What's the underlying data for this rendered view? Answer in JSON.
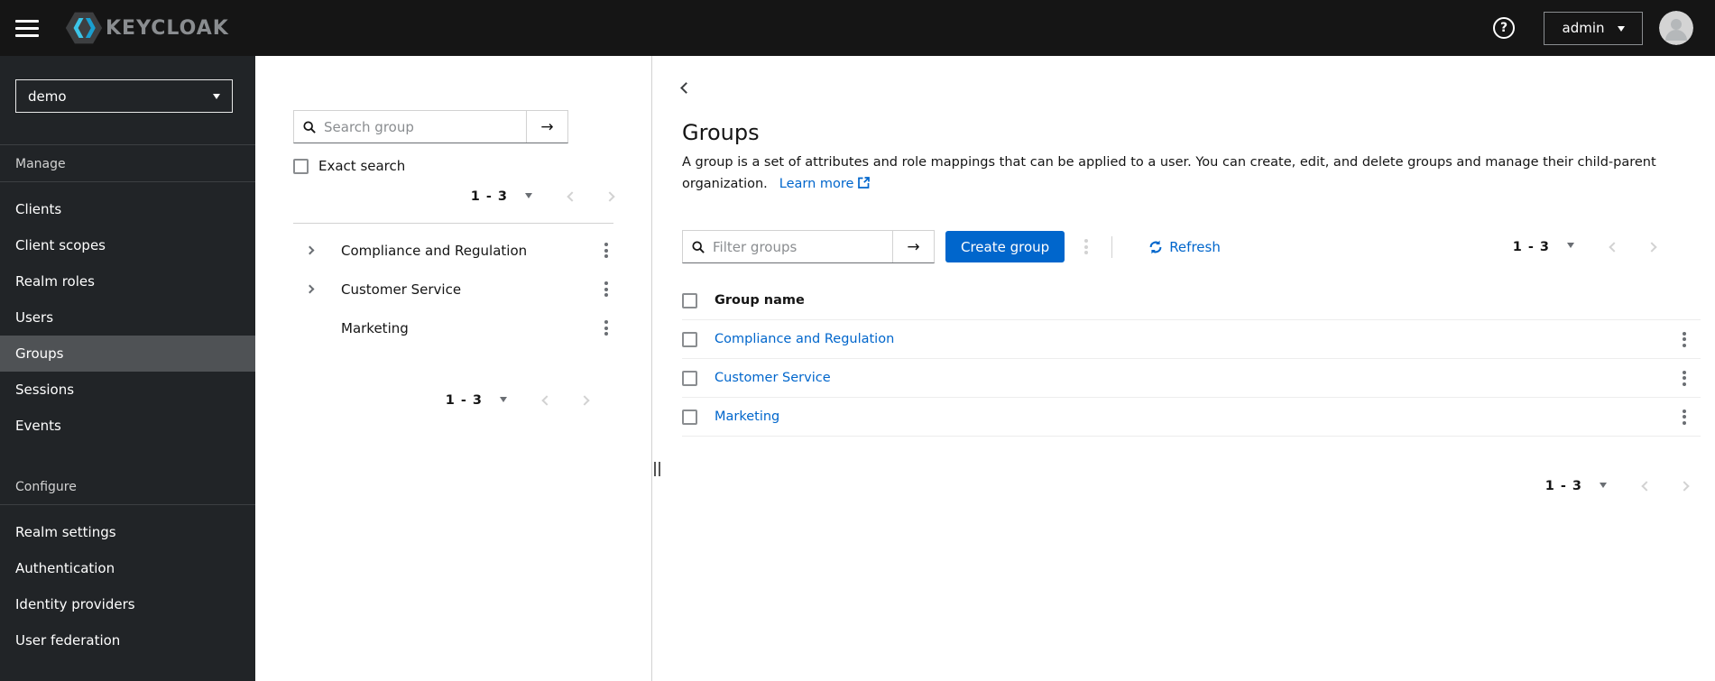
{
  "header": {
    "brand_text": "KEYCLOAK",
    "help_icon": "?",
    "user_menu_label": "admin"
  },
  "sidebar": {
    "realm_select_value": "demo",
    "manage_section_label": "Manage",
    "manage_items": [
      "Clients",
      "Client scopes",
      "Realm roles",
      "Users",
      "Groups",
      "Sessions",
      "Events"
    ],
    "active_item": "Groups",
    "configure_section_label": "Configure",
    "configure_items": [
      "Realm settings",
      "Authentication",
      "Identity providers",
      "User federation"
    ]
  },
  "group_tree": {
    "search_placeholder": "Search group",
    "search_submit_icon": "→",
    "exact_search_label": "Exact search",
    "pagination_top": "1 - 3",
    "items": [
      {
        "label": "Compliance and Regulation",
        "expandable": true
      },
      {
        "label": "Customer Service",
        "expandable": true
      },
      {
        "label": "Marketing",
        "expandable": false
      }
    ],
    "pagination_bottom": "1 - 3"
  },
  "main": {
    "title": "Groups",
    "description": "A group is a set of attributes and role mappings that can be applied to a user. You can create, edit, and delete groups and manage their child-parent organization.",
    "learn_more_label": "Learn more",
    "toolbar": {
      "filter_placeholder": "Filter groups",
      "filter_submit_icon": "→",
      "create_button_label": "Create group",
      "refresh_label": "Refresh",
      "pagination": "1 - 3"
    },
    "table": {
      "name_column_header": "Group name",
      "rows": [
        "Compliance and Regulation",
        "Customer Service",
        "Marketing"
      ]
    },
    "pagination_bottom": "1 - 3"
  },
  "colors": {
    "accent_blue": "#0066cc",
    "link_blue": "#0066cc",
    "masthead_bg": "#151515",
    "sidebar_bg": "#212427",
    "sidebar_active_bg": "#4f5255",
    "row_border": "#ededed",
    "logo_cyan": "#3cc5e8"
  }
}
